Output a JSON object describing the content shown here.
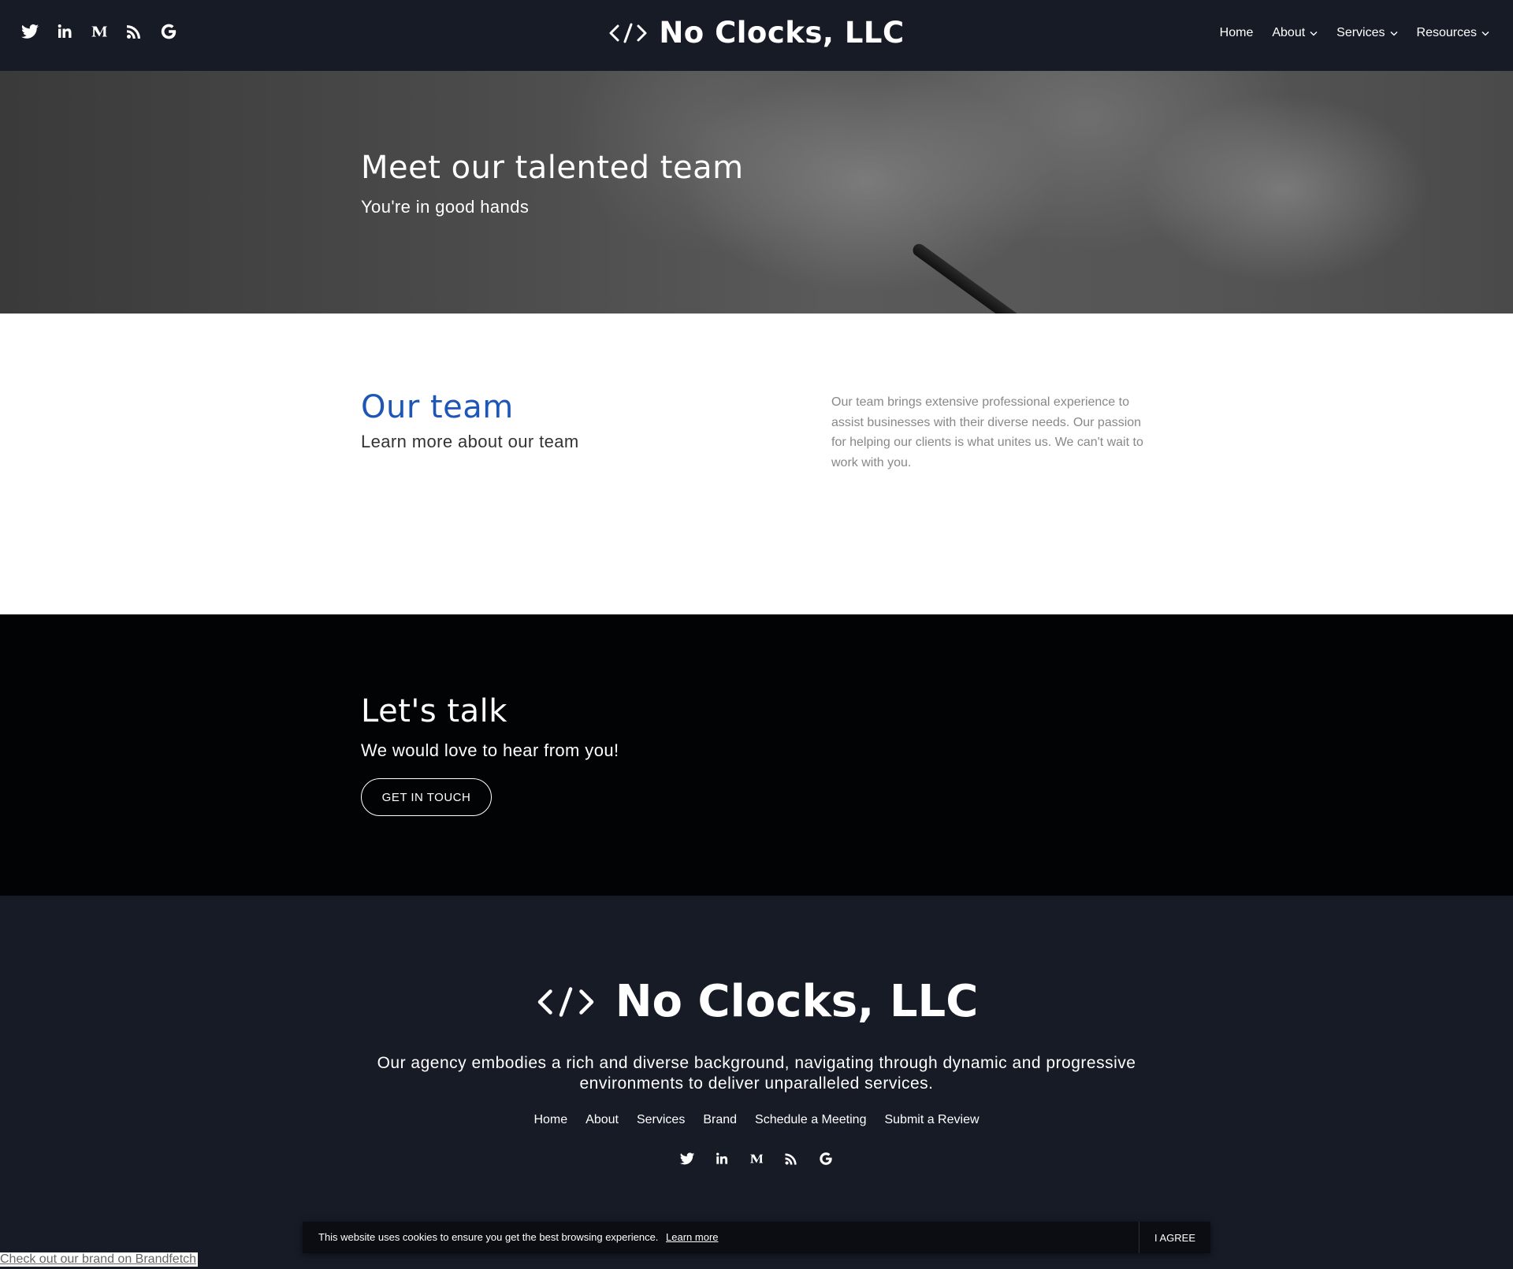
{
  "header": {
    "logo_text": "No Clocks, LLC",
    "social": [
      "twitter-icon",
      "linkedin-icon",
      "medium-icon",
      "rss-icon",
      "google-icon"
    ],
    "nav": [
      {
        "label": "Home",
        "dropdown": false
      },
      {
        "label": "About",
        "dropdown": true
      },
      {
        "label": "Services",
        "dropdown": true
      },
      {
        "label": "Resources",
        "dropdown": true
      }
    ]
  },
  "hero": {
    "title": "Meet our talented team",
    "subtitle": "You're in good hands"
  },
  "team": {
    "title": "Our team",
    "subtitle": "Learn more about our team",
    "description": "Our team brings extensive professional experience to assist businesses with their diverse needs. Our passion for helping our clients is what unites us. We can't wait to work with you."
  },
  "cta": {
    "title": "Let's talk",
    "subtitle": "We would love to hear from you!",
    "button": "GET IN TOUCH"
  },
  "footer": {
    "logo_text": "No Clocks, LLC",
    "description": "Our agency embodies a rich and diverse background, navigating through dynamic and progressive environments to deliver unparalleled services.",
    "links": [
      "Home",
      "About",
      "Services",
      "Brand",
      "Schedule a Meeting",
      "Submit a Review"
    ]
  },
  "cookie": {
    "text": "This website uses cookies to ensure you get the best browsing experience.",
    "learn_more": "Learn more",
    "agree": "I AGREE"
  },
  "brandfetch_link": "Check out our brand on Brandfetch",
  "colors": {
    "header_bg": "#161b26",
    "cta_bg": "#020305",
    "accent_blue": "#1e56b8",
    "body_text_gray": "#888888"
  }
}
